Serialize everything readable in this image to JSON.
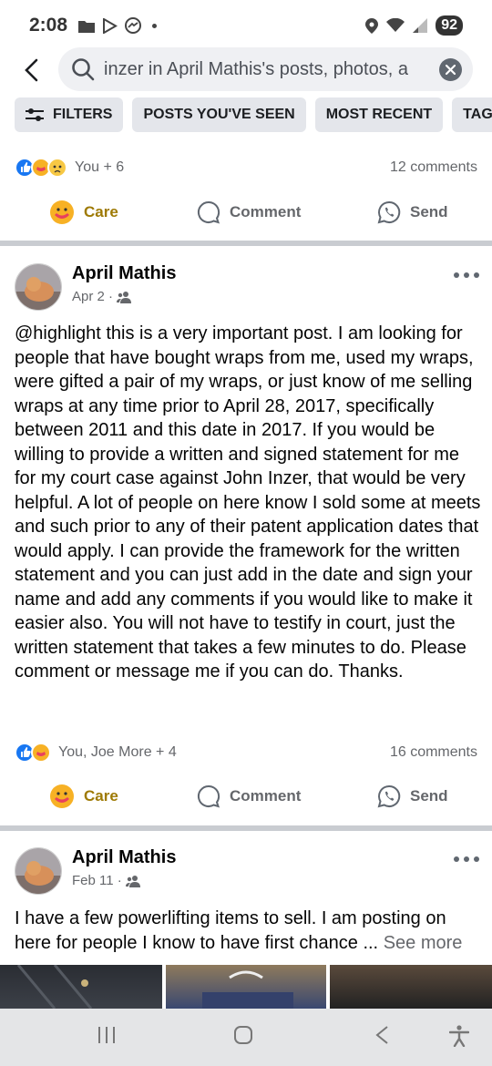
{
  "status_bar": {
    "time": "2:08",
    "battery": "92"
  },
  "search": {
    "query": "inzer in April Mathis's posts, photos, a"
  },
  "filters": [
    "FILTERS",
    "POSTS YOU'VE SEEN",
    "MOST RECENT",
    "TAGGED L"
  ],
  "first_post": {
    "reactions_text": "You + 6",
    "comments": "12 comments",
    "actions": {
      "care": "Care",
      "comment": "Comment",
      "send": "Send"
    }
  },
  "posts": [
    {
      "author": "April Mathis",
      "date": "Apr 2 ·",
      "text": "@highlight this is a very important post. I am looking for people that have bought wraps from me, used my wraps, were gifted a pair of my wraps, or just know of me selling wraps at any time prior to April 28, 2017, specifically between 2011 and this date in 2017. If you would be willing to provide a written and signed statement for me for my court case against John Inzer, that would be very helpful. A lot of people on here know I sold some at meets and such prior to any of their patent application dates that would apply. I can provide the framework for the written statement and you can just add in the date and sign your name and add any comments if you would like to make it easier also. You will not have to testify in court, just the written statement that takes a few minutes to do. Please comment or message me if you can do. Thanks.",
      "reactions_text": "You, Joe More + 4",
      "comments": "16 comments",
      "actions": {
        "care": "Care",
        "comment": "Comment",
        "send": "Send"
      }
    },
    {
      "author": "April Mathis",
      "date": "Feb 11 ·",
      "text": "I have a few powerlifting items to sell. I am posting on here for people I know to have first chance ...",
      "see_more": "See more"
    }
  ],
  "colors": {
    "care": "#9e7a04",
    "like_blue": "#1877f2",
    "muted": "#65676b"
  }
}
